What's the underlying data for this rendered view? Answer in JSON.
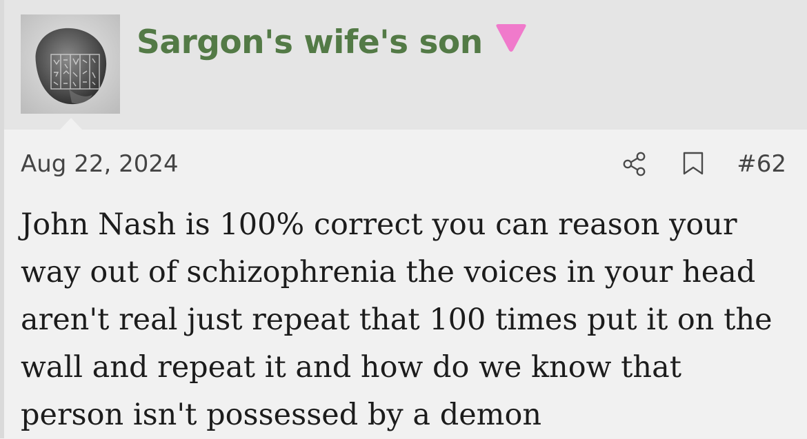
{
  "post": {
    "username": "Sargon's wife's son",
    "flair_color": "#f07acb",
    "username_color": "#537a46",
    "date": "Aug 22, 2024",
    "post_number": "#62",
    "message": "John Nash is 100% correct you can reason your way out of schizophrenia the voices in your head aren't real just repeat that 100 times put it on the wall and repeat it and how do we know that person isn't possessed by a demon",
    "icons": {
      "share": "share-icon",
      "bookmark": "bookmark-icon",
      "flair": "pink-triangle-icon",
      "avatar": "clay-tablet-avatar"
    }
  }
}
